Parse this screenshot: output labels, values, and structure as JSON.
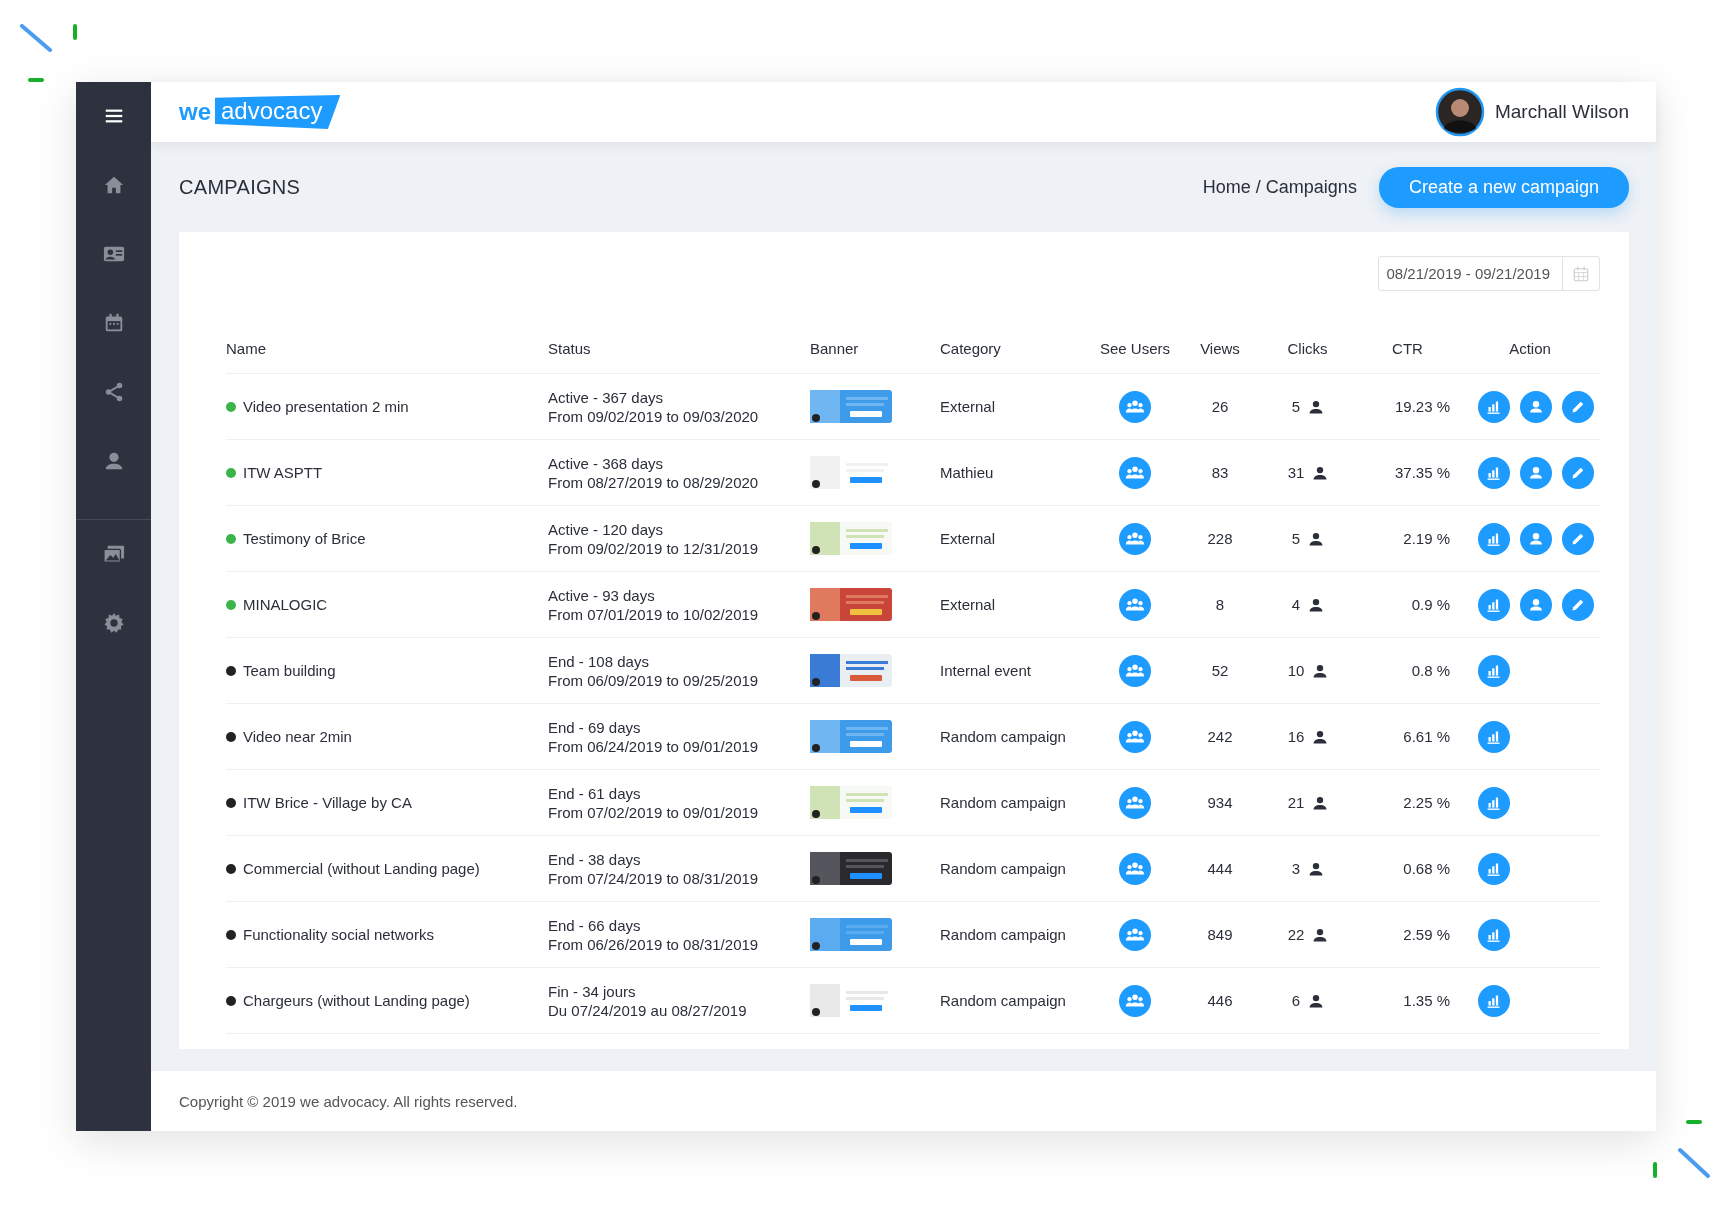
{
  "header": {
    "logo_prefix": "we",
    "logo_word": "advocacy",
    "user_name": "Marchall Wilson"
  },
  "page": {
    "title": "CAMPAIGNS",
    "breadcrumb": "Home / Campaigns",
    "create_button": "Create a new campaign"
  },
  "filter": {
    "date_range": "08/21/2019 - 09/21/2019"
  },
  "table": {
    "columns": [
      "Name",
      "Status",
      "Banner",
      "Category",
      "See Users",
      "Views",
      "Clicks",
      "CTR",
      "Action"
    ],
    "rows": [
      {
        "name": "Video presentation 2 min",
        "color": "#3bb54a",
        "status": "Active - 367 days",
        "period": "From 09/02/2019 to 09/03/2020",
        "category": "External",
        "views": "26",
        "clicks": "5",
        "ctr": "19.23 %",
        "actions": [
          {
            "kind": "stats"
          },
          {
            "kind": "user"
          },
          {
            "kind": "edit"
          }
        ]
      },
      {
        "name": "ITW ASPTT",
        "color": "#3bb54a",
        "status": "Active - 368 days",
        "period": "From 08/27/2019 to 08/29/2020",
        "category": "Mathieu",
        "views": "83",
        "clicks": "31",
        "ctr": "37.35 %",
        "actions": [
          {
            "kind": "stats"
          },
          {
            "kind": "user"
          },
          {
            "kind": "edit"
          }
        ]
      },
      {
        "name": "Testimony of Brice",
        "color": "#3bb54a",
        "status": "Active - 120 days",
        "period": "From 09/02/2019 to 12/31/2019",
        "category": "External",
        "views": "228",
        "clicks": "5",
        "ctr": "2.19 %",
        "actions": [
          {
            "kind": "stats"
          },
          {
            "kind": "user"
          },
          {
            "kind": "edit"
          }
        ]
      },
      {
        "name": "MINALOGIC",
        "color": "#3bb54a",
        "status": "Active - 93 days",
        "period": "From 07/01/2019 to 10/02/2019",
        "category": "External",
        "views": "8",
        "clicks": "4",
        "ctr": "0.9 %",
        "actions": [
          {
            "kind": "stats"
          },
          {
            "kind": "user"
          },
          {
            "kind": "edit"
          }
        ]
      },
      {
        "name": "Team building",
        "color": "#222222",
        "status": "End - 108 days",
        "period": "From 06/09/2019 to 09/25/2019",
        "category": "Internal event",
        "views": "52",
        "clicks": "10",
        "ctr": "0.8 %",
        "actions": [
          {
            "kind": "stats"
          }
        ]
      },
      {
        "name": "Video near 2min",
        "color": "#222222",
        "status": "End - 69 days",
        "period": "From 06/24/2019 to 09/01/2019",
        "category": "Random campaign",
        "views": "242",
        "clicks": "16",
        "ctr": "6.61 %",
        "actions": [
          {
            "kind": "stats"
          }
        ]
      },
      {
        "name": "ITW Brice - Village by CA",
        "color": "#222222",
        "status": "End - 61 days",
        "period": "From 07/02/2019 to 09/01/2019",
        "category": "Random campaign",
        "views": "934",
        "clicks": "21",
        "ctr": "2.25 %",
        "actions": [
          {
            "kind": "stats"
          }
        ]
      },
      {
        "name": "Commercial (without Landing page)",
        "color": "#222222",
        "status": "End - 38 days",
        "period": "From 07/24/2019 to 08/31/2019",
        "category": "Random campaign",
        "views": "444",
        "clicks": "3",
        "ctr": "0.68 %",
        "actions": [
          {
            "kind": "stats"
          }
        ]
      },
      {
        "name": "Functionality social networks",
        "color": "#222222",
        "status": "End - 66 days",
        "period": "From 06/26/2019 to 08/31/2019",
        "category": "Random campaign",
        "views": "849",
        "clicks": "22",
        "ctr": "2.59 %",
        "actions": [
          {
            "kind": "stats"
          }
        ]
      },
      {
        "name": "Chargeurs (without Landing page)",
        "color": "#222222",
        "status": "Fin - 34 jours",
        "period": "Du 07/24/2019 au 08/27/2019",
        "category": "Random campaign",
        "views": "446",
        "clicks": "6",
        "ctr": "1.35 %",
        "actions": [
          {
            "kind": "stats"
          }
        ]
      }
    ]
  },
  "footer": {
    "copyright": "Copyright © 2019 we advocacy. All rights reserved."
  }
}
